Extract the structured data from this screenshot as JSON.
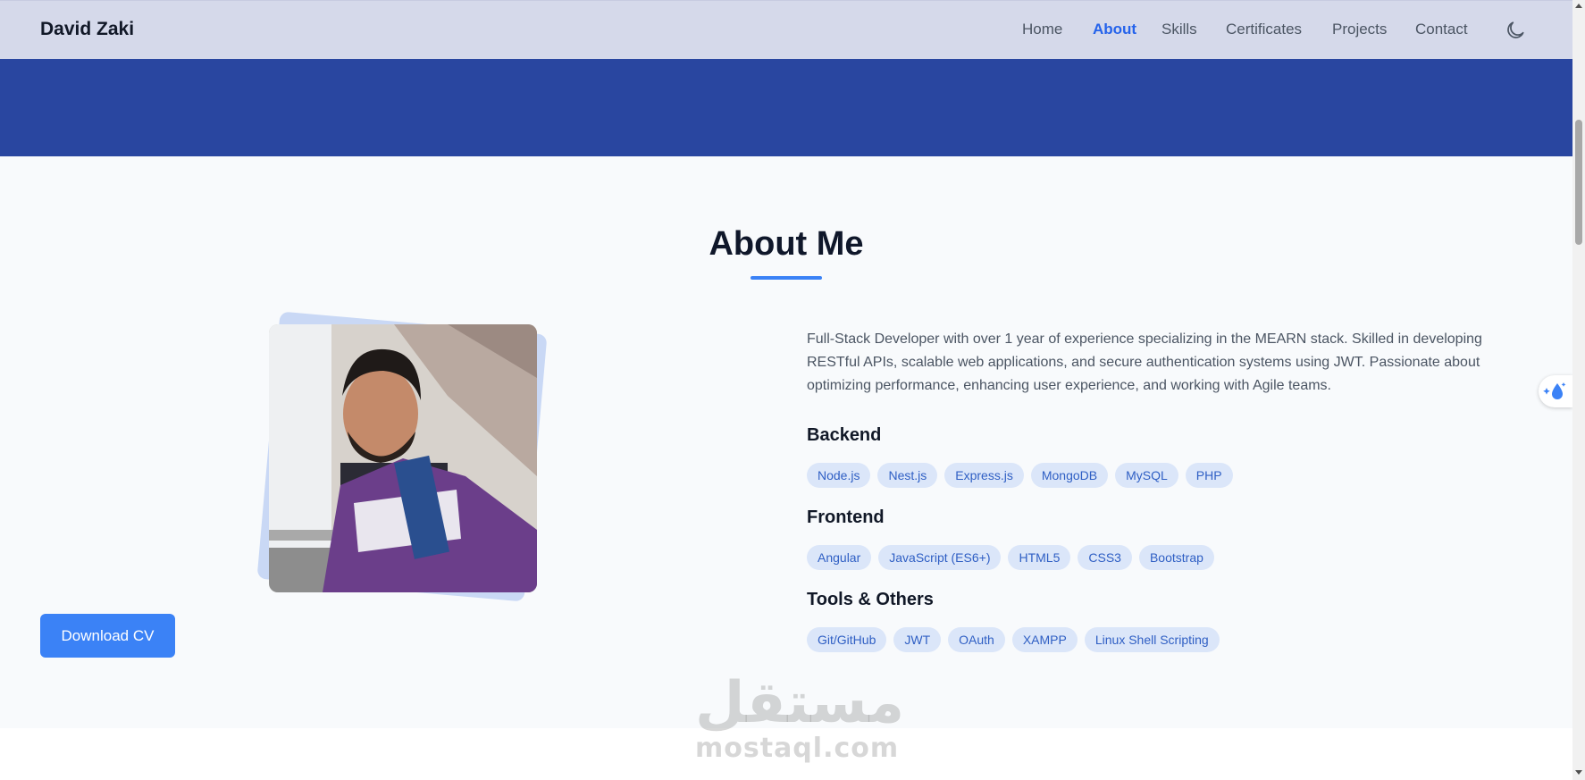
{
  "navbar": {
    "brand": "David Zaki",
    "links": [
      {
        "label": "Home",
        "active": false
      },
      {
        "label": "About",
        "active": true
      },
      {
        "label": "Skills",
        "active": false
      },
      {
        "label": "Certificates",
        "active": false
      },
      {
        "label": "Projects",
        "active": false
      },
      {
        "label": "Contact",
        "active": false
      }
    ],
    "theme_icon": "moon-icon"
  },
  "about": {
    "title": "About Me",
    "bio": "Full-Stack Developer with over 1 year of experience specializing in the MEARN stack. Skilled in developing RESTful APIs, scalable web applications, and secure authentication systems using JWT. Passionate about optimizing performance, enhancing user experience, and working with Agile teams.",
    "download_label": "Download CV",
    "skill_groups": [
      {
        "title": "Backend",
        "skills": [
          "Node.js",
          "Nest.js",
          "Express.js",
          "MongoDB",
          "MySQL",
          "PHP"
        ]
      },
      {
        "title": "Frontend",
        "skills": [
          "Angular",
          "JavaScript (ES6+)",
          "HTML5",
          "CSS3",
          "Bootstrap"
        ]
      },
      {
        "title": "Tools & Others",
        "skills": [
          "Git/GitHub",
          "JWT",
          "OAuth",
          "XAMPP",
          "Linux Shell Scripting"
        ]
      }
    ]
  },
  "watermark": {
    "arabic": "مستقل",
    "latin": "mostaql.com"
  },
  "colors": {
    "accent": "#3b82f6",
    "hero": "#2946a0",
    "navbar": "#d5d9ea",
    "chip_bg": "#dbe6f9",
    "chip_text": "#2f5fc4"
  }
}
